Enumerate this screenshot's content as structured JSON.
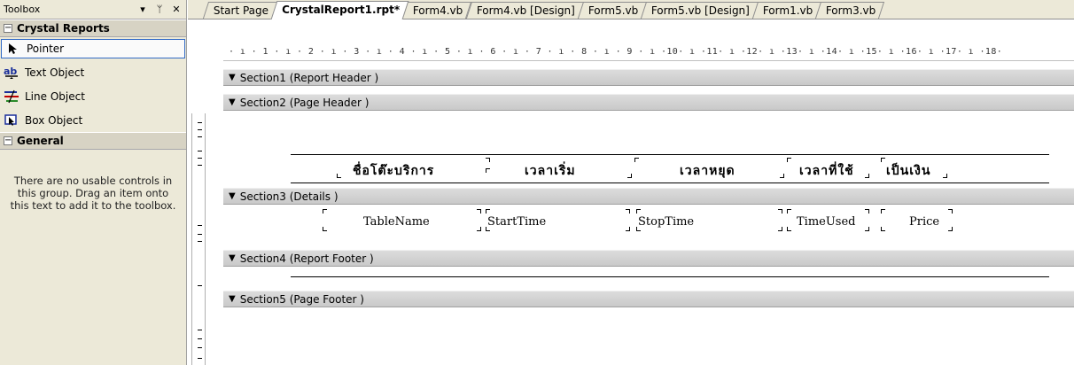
{
  "toolbox": {
    "title": "Toolbox",
    "dropdown_icon": "▾",
    "pin_icon": "ᛘ",
    "close_icon": "✕",
    "group_crystal": "Crystal Reports",
    "group_general": "General",
    "items": [
      {
        "label": "Pointer",
        "icon": "pointer-icon"
      },
      {
        "label": "Text Object",
        "icon": "text-object-icon"
      },
      {
        "label": "Line Object",
        "icon": "line-object-icon"
      },
      {
        "label": "Box Object",
        "icon": "box-object-icon"
      }
    ],
    "empty_message": "There are no usable controls in this group. Drag an item onto this text to add it to the toolbox."
  },
  "tabs": [
    {
      "label": "Start Page",
      "active": false
    },
    {
      "label": "CrystalReport1.rpt*",
      "active": true
    },
    {
      "label": "Form4.vb",
      "active": false
    },
    {
      "label": "Form4.vb [Design]",
      "active": false
    },
    {
      "label": "Form5.vb",
      "active": false
    },
    {
      "label": "Form5.vb [Design]",
      "active": false
    },
    {
      "label": "Form1.vb",
      "active": false
    },
    {
      "label": "Form3.vb",
      "active": false
    }
  ],
  "ruler": "· ı · 1 · ı · 2 · ı · 3 · ı · 4 · ı · 5 · ı · 6 · ı · 7 · ı · 8 · ı · 9 · ı ·10· ı ·11· ı ·12· ı ·13· ı ·14· ı ·15· ı ·16· ı ·17· ı ·18·",
  "sections": {
    "s1": "Section1 (Report Header )",
    "s2": "Section2 (Page Header )",
    "s3": "Section3 (Details )",
    "s4": "Section4 (Report Footer )",
    "s5": "Section5 (Page Footer )"
  },
  "page_header_columns": [
    "ชื่อโต๊ะบริการ",
    "เวลาเริ่ม",
    "เวลาหยุด",
    "เวลาที่ใช้",
    "เป็นเงิน"
  ],
  "detail_fields": [
    "TableName",
    "StartTime",
    "StopTime",
    "TimeUsed",
    "Price"
  ],
  "colors": {
    "section_bar": "#d0d0d0",
    "toolbox_bg": "#ece9d8",
    "selection_border": "#316ac5"
  }
}
